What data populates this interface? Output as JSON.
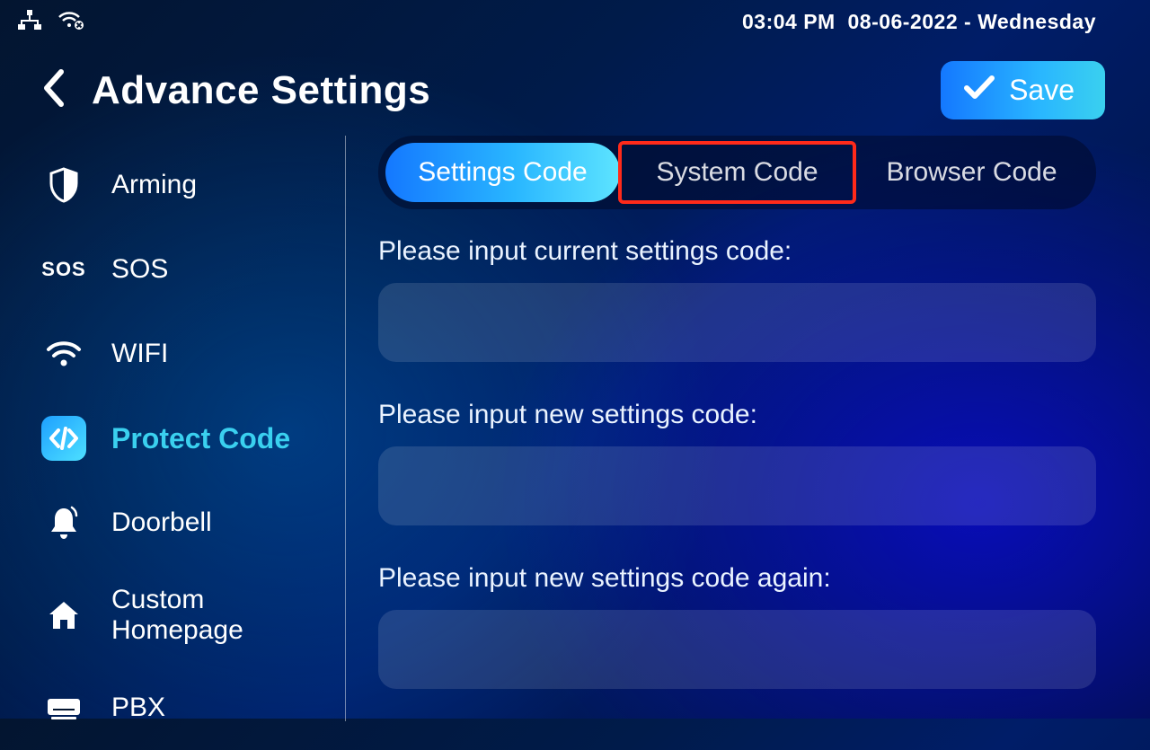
{
  "status": {
    "time": "03:04 PM",
    "date": "08-06-2022",
    "day": "Wednesday"
  },
  "header": {
    "title": "Advance Settings",
    "save": "Save"
  },
  "sidebar": {
    "items": [
      {
        "label": "Arming"
      },
      {
        "label": "SOS"
      },
      {
        "label": "WIFI"
      },
      {
        "label": "Protect Code"
      },
      {
        "label": "Doorbell"
      },
      {
        "label": "Custom Homepage"
      },
      {
        "label": "PBX"
      }
    ]
  },
  "tabs": [
    {
      "label": "Settings Code"
    },
    {
      "label": "System Code"
    },
    {
      "label": "Browser Code"
    }
  ],
  "form": {
    "current_label": "Please input current settings code:",
    "new_label": "Please input new settings code:",
    "again_label": "Please input new settings code again:"
  }
}
